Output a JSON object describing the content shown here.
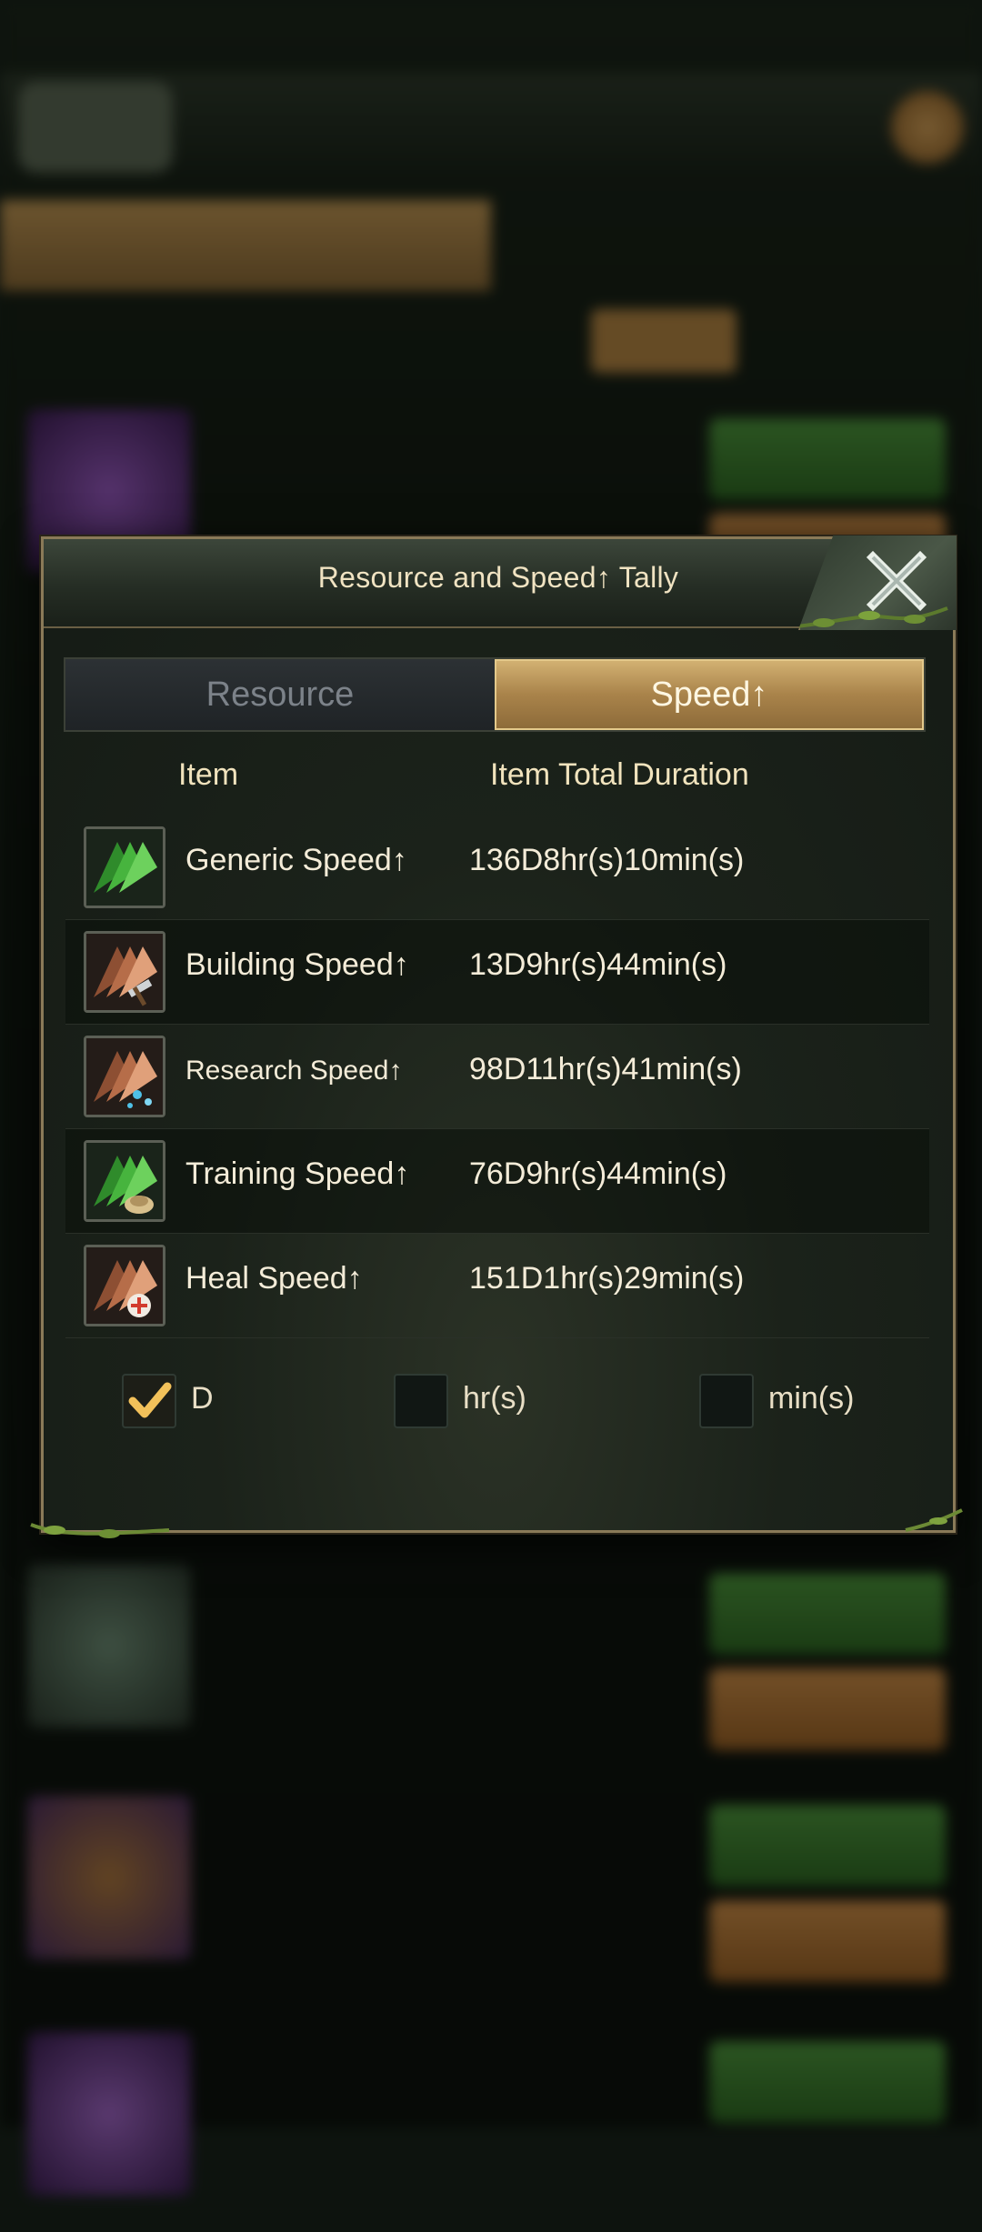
{
  "dialog": {
    "title": "Resource and Speed↑ Tally",
    "tabs": [
      {
        "label": "Resource",
        "active": false
      },
      {
        "label": "Speed↑",
        "active": true
      }
    ],
    "columns": {
      "item": "Item",
      "duration": "Item Total Duration"
    },
    "rows": [
      {
        "label": "Generic Speed↑",
        "value": "136D8hr(s)10min(s)",
        "icon": "green-speed-arrows-icon"
      },
      {
        "label": "Building Speed↑",
        "value": "13D9hr(s)44min(s)",
        "icon": "building-speed-hammer-icon"
      },
      {
        "label": "Research Speed↑",
        "value": "98D11hr(s)41min(s)",
        "icon": "research-speed-flask-icon"
      },
      {
        "label": "Training Speed↑",
        "value": "76D9hr(s)44min(s)",
        "icon": "training-speed-helmet-icon"
      },
      {
        "label": "Heal Speed↑",
        "value": "151D1hr(s)29min(s)",
        "icon": "heal-speed-cross-icon"
      }
    ],
    "units": [
      {
        "label": "D",
        "checked": true
      },
      {
        "label": "hr(s)",
        "checked": false
      },
      {
        "label": "min(s)",
        "checked": false
      }
    ]
  },
  "colors": {
    "accent_gold": "#c8a063",
    "green_icon": "#3fae3a",
    "copper_icon": "#c9805a",
    "check": "#f2c15a"
  }
}
